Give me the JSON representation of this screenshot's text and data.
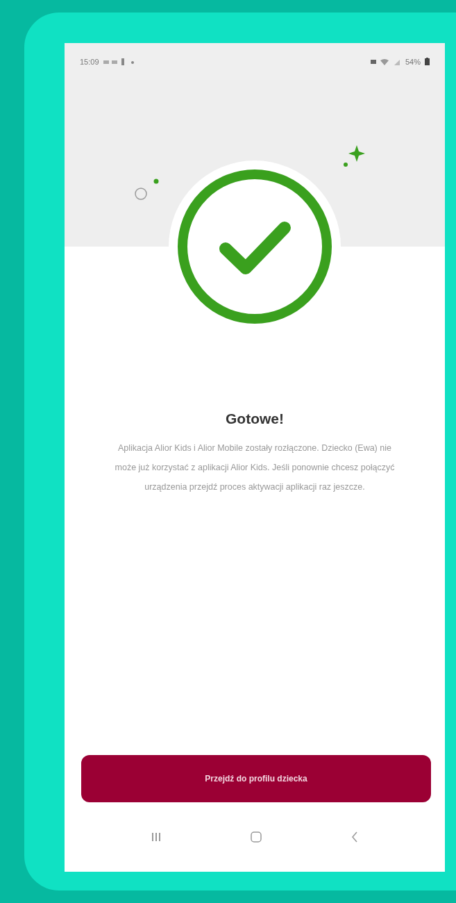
{
  "status_bar": {
    "time": "15:09",
    "battery": "54%"
  },
  "title": "Gotowe!",
  "message": "Aplikacja Alior Kids i Alior Mobile zostały rozłączone. Dziecko (Ewa) nie może już korzystać z aplikacji Alior Kids. Jeśli ponownie chcesz połączyć urządzenia przejdź proces aktywacji aplikacji raz jeszcze.",
  "button": "Przejdź do profilu dziecka"
}
